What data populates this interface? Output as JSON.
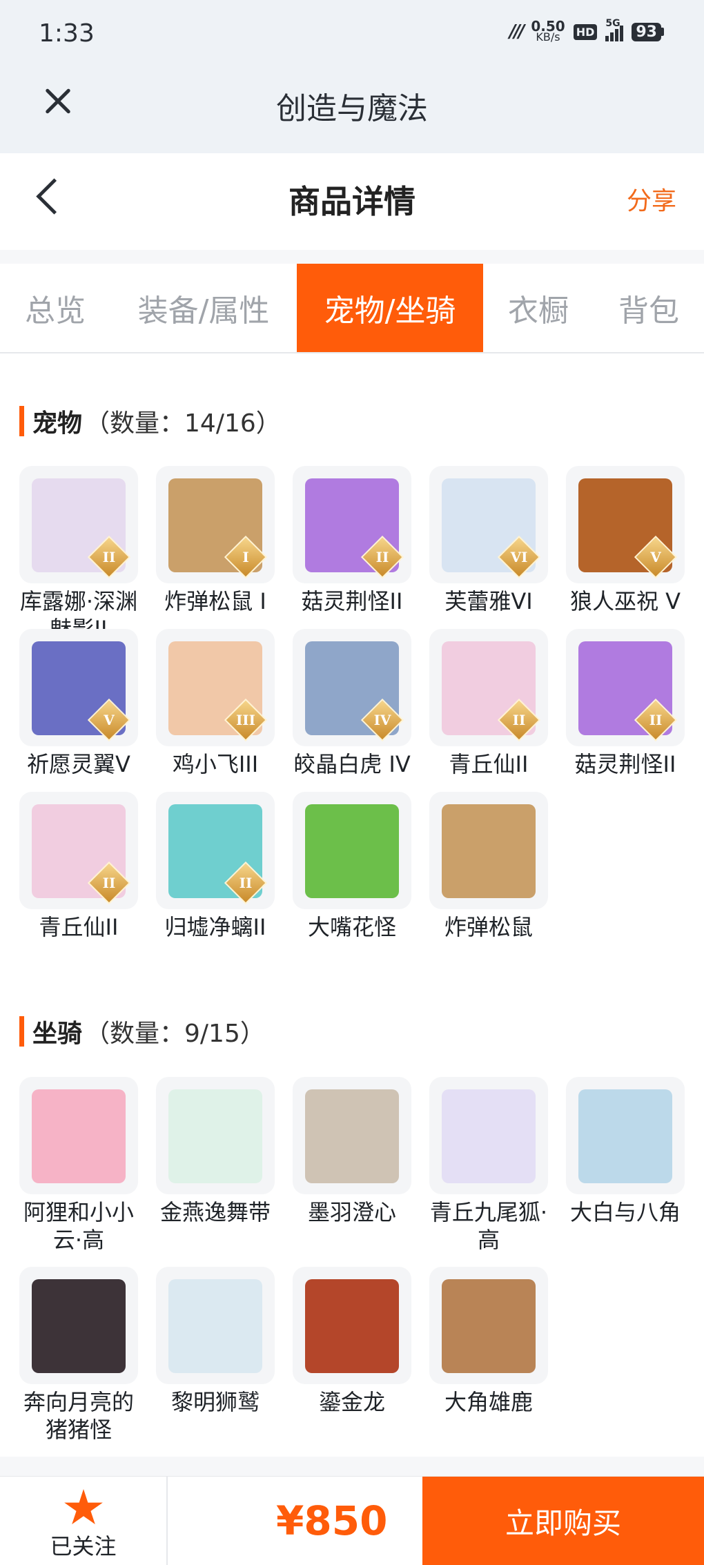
{
  "status_bar": {
    "time": "1:33",
    "net_speed_value": "0.50",
    "net_speed_unit": "KB/s",
    "hd": "HD",
    "network": "5G",
    "battery": "93"
  },
  "app_bar": {
    "title": "创造与魔法"
  },
  "header": {
    "title": "商品详情",
    "share": "分享"
  },
  "tabs": [
    {
      "label": "总览",
      "active": false
    },
    {
      "label": "装备/属性",
      "active": false
    },
    {
      "label": "宠物/坐骑",
      "active": true
    },
    {
      "label": "衣橱",
      "active": false
    },
    {
      "label": "背包",
      "active": false
    }
  ],
  "pets": {
    "title": "宠物",
    "count": "（数量：14/16）",
    "items": [
      {
        "name": "库露娜·深渊魅影II",
        "rank": "II",
        "art": "#e6dbef"
      },
      {
        "name": "炸弹松鼠 I",
        "rank": "I",
        "art": "#caa06a"
      },
      {
        "name": "菇灵荆怪II",
        "rank": "II",
        "art": "#b07be0"
      },
      {
        "name": "芙蕾雅VI",
        "rank": "VI",
        "art": "#d8e4f2"
      },
      {
        "name": "狼人巫祝 V",
        "rank": "V",
        "art": "#b5642a"
      },
      {
        "name": "祈愿灵翼V",
        "rank": "V",
        "art": "#6a6fc4"
      },
      {
        "name": "鸡小飞III",
        "rank": "III",
        "art": "#f1c8a8"
      },
      {
        "name": "皎晶白虎 IV",
        "rank": "IV",
        "art": "#8fa6c9"
      },
      {
        "name": "青丘仙II",
        "rank": "II",
        "art": "#f1cde0"
      },
      {
        "name": "菇灵荆怪II",
        "rank": "II",
        "art": "#b07be0"
      },
      {
        "name": "青丘仙II",
        "rank": "II",
        "art": "#f1cde0"
      },
      {
        "name": "归墟净螭II",
        "rank": "II",
        "art": "#6fcfcf"
      },
      {
        "name": "大嘴花怪",
        "rank": "",
        "art": "#6cbf4a"
      },
      {
        "name": "炸弹松鼠",
        "rank": "",
        "art": "#caa06a"
      }
    ]
  },
  "mounts": {
    "title": "坐骑",
    "count": "（数量：9/15）",
    "items": [
      {
        "name": "阿狸和小小云·高",
        "art": "#f6b3c6"
      },
      {
        "name": "金燕逸舞带",
        "art": "#dff2e8"
      },
      {
        "name": "墨羽澄心",
        "art": "#cfc3b4"
      },
      {
        "name": "青丘九尾狐·高",
        "art": "#e4dff5"
      },
      {
        "name": "大白与八角",
        "art": "#bcd9ea"
      },
      {
        "name": "奔向月亮的猪猪怪",
        "art": "#3d3338"
      },
      {
        "name": "黎明狮鹫",
        "art": "#dbe9f1"
      },
      {
        "name": "鎏金龙",
        "art": "#b4462a"
      },
      {
        "name": "大角雄鹿",
        "art": "#b98456"
      }
    ]
  },
  "footer": {
    "follow_label": "已关注",
    "price": "¥850",
    "buy_label": "立即购买"
  }
}
